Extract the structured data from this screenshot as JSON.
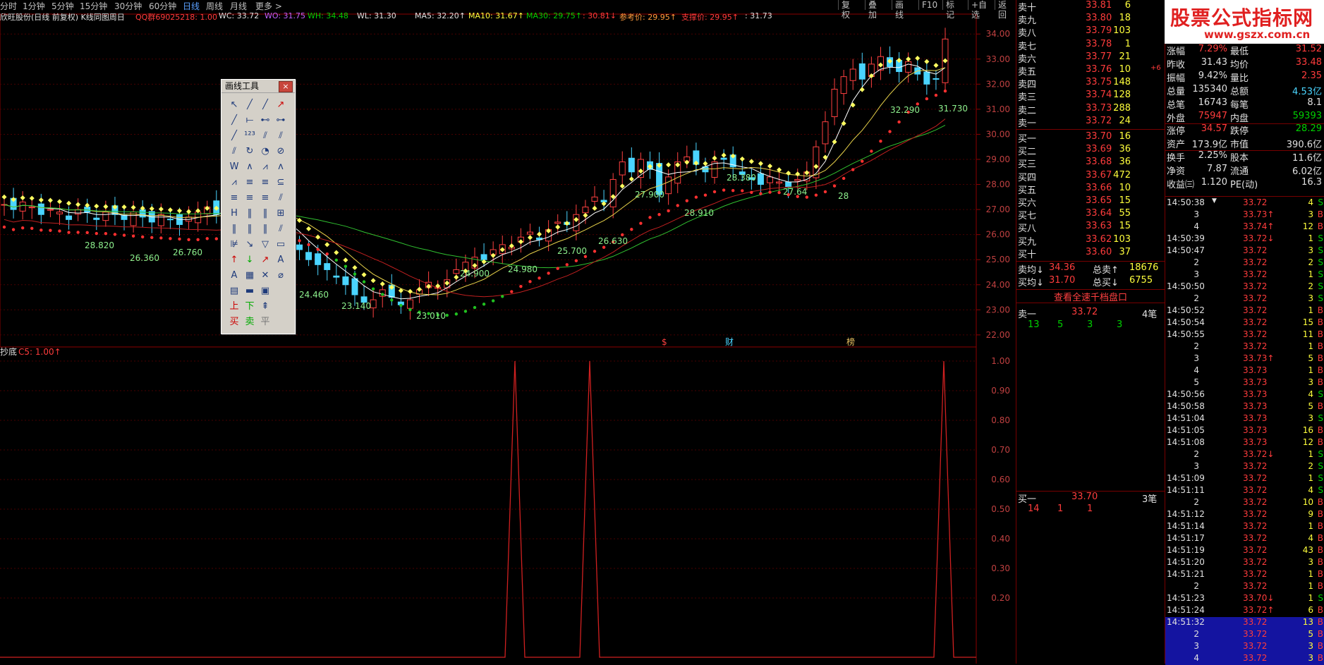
{
  "top_tabs": [
    "分时",
    "1分钟",
    "5分钟",
    "15分钟",
    "30分钟",
    "60分钟",
    "日线",
    "周线",
    "月线",
    "更多 >"
  ],
  "top_buttons": [
    "复权",
    "叠加",
    "画线",
    "F10",
    "标记",
    "+自选",
    "返回"
  ],
  "info": {
    "stock": "欣旺股份(日线 前复权) K线同图周日",
    "qq": "QQ群69025218: 1.00",
    "wc": "WC: 33.72",
    "wo": "WO: 31.75",
    "wh": "WH: 34.48",
    "wl": "WL: 31.30",
    "ma5": "MA5: 32.20↑",
    "ma10": "MA10: 31.67↑",
    "ma30": "MA30: 29.75↑",
    "ma_extra": ": 30.81↓",
    "ref": "参考价: 29.95↑",
    "support": "支撑价: 29.95↑",
    "last": ": 31.73"
  },
  "price_axis": [
    "34.00",
    "33.00",
    "32.00",
    "31.00",
    "30.00",
    "29.00",
    "28.00",
    "27.00",
    "26.00",
    "25.00",
    "24.00",
    "23.00",
    "22.00"
  ],
  "osc_axis": [
    "1.00",
    "0.90",
    "0.80",
    "0.70",
    "0.60",
    "0.50",
    "0.40",
    "0.30",
    "0.20"
  ],
  "osc_title": "抄底",
  "osc_value": "C5: 1.00↑",
  "price_labels": [
    {
      "t": "28.820"
    },
    {
      "t": "26.360"
    },
    {
      "t": "26.760"
    },
    {
      "t": "24.460"
    },
    {
      "t": "23.140"
    },
    {
      "t": "23.010"
    },
    {
      "t": "24.900"
    },
    {
      "t": "24.980"
    },
    {
      "t": "25.700"
    },
    {
      "t": "26.630"
    },
    {
      "t": "27.900"
    },
    {
      "t": "28.910"
    },
    {
      "t": "28.380"
    },
    {
      "t": "27.64"
    },
    {
      "t": "28"
    },
    {
      "t": "32.290"
    },
    {
      "t": "31.730"
    }
  ],
  "markers": [
    "$",
    "财",
    "榜"
  ],
  "palette": {
    "title": "画线工具",
    "close": "×",
    "tools": [
      "↖",
      "╱",
      "╱",
      "↗",
      "╱",
      "⟝",
      "⊷",
      "⊶",
      "╱",
      "¹²³",
      "⫽",
      "⫽",
      "⫽",
      "↻",
      "◔",
      "⊘",
      "W",
      "∧",
      "⩘",
      "ʌ",
      "⩘",
      "≡",
      "≡",
      "⊆",
      "≡",
      "≡",
      "≡",
      "⫽",
      "H",
      "‖",
      "‖",
      "⊞",
      "‖",
      "‖",
      "‖",
      "⫽",
      "⊯",
      "↘",
      "▽",
      "▭",
      "↑",
      "↓",
      "↗",
      "A",
      "A",
      "▦",
      "✕",
      "⌀",
      "▤",
      "▬",
      "▣",
      "",
      "上",
      "下",
      "⇞",
      "",
      "买",
      "卖",
      "平",
      ""
    ]
  },
  "orderbook": {
    "asks": [
      {
        "l": "卖十",
        "p": "33.81",
        "v": "6",
        "flag": "*"
      },
      {
        "l": "卖九",
        "p": "33.80",
        "v": "18"
      },
      {
        "l": "卖八",
        "p": "33.79",
        "v": "103"
      },
      {
        "l": "卖七",
        "p": "33.78",
        "v": "1"
      },
      {
        "l": "卖六",
        "p": "33.77",
        "v": "21"
      },
      {
        "l": "卖五",
        "p": "33.76",
        "v": "10",
        "x": "+6"
      },
      {
        "l": "卖四",
        "p": "33.75",
        "v": "148"
      },
      {
        "l": "卖三",
        "p": "33.74",
        "v": "128"
      },
      {
        "l": "卖二",
        "p": "33.73",
        "v": "288"
      },
      {
        "l": "卖一",
        "p": "33.72",
        "v": "24"
      }
    ],
    "bids": [
      {
        "l": "买一",
        "p": "33.70",
        "v": "16"
      },
      {
        "l": "买二",
        "p": "33.69",
        "v": "36"
      },
      {
        "l": "买三",
        "p": "33.68",
        "v": "36"
      },
      {
        "l": "买四",
        "p": "33.67",
        "v": "472"
      },
      {
        "l": "买五",
        "p": "33.66",
        "v": "10"
      },
      {
        "l": "买六",
        "p": "33.65",
        "v": "15"
      },
      {
        "l": "买七",
        "p": "33.64",
        "v": "55"
      },
      {
        "l": "买八",
        "p": "33.63",
        "v": "15"
      },
      {
        "l": "买九",
        "p": "33.62",
        "v": "103"
      },
      {
        "l": "买十",
        "p": "33.60",
        "v": "37",
        "flag": "*"
      }
    ],
    "avg_ask_label": "卖均",
    "avg_ask": "34.36",
    "total_ask_label": "总卖",
    "total_ask": "18676",
    "avg_bid_label": "买均",
    "avg_bid": "31.70",
    "total_bid_label": "总买",
    "total_bid": "6755",
    "full_depth": "查看全速千档盘口",
    "q1_label": "卖一",
    "q1_price": "33.72",
    "q1_count": "4笔",
    "q1_orders": [
      "13",
      "5",
      "3",
      "3"
    ],
    "q2_label": "买一",
    "q2_price": "33.70",
    "q2_count": "3笔",
    "q2_orders": [
      "14",
      "1",
      "1"
    ]
  },
  "stats": {
    "logo_cn": "股票公式指标网",
    "logo_url": "www.gszx.com.cn",
    "rows": [
      [
        {
          "k": "涨幅",
          "v": "7.29%",
          "c": "red"
        },
        {
          "k": "最低",
          "v": "31.52",
          "c": "red"
        }
      ],
      [
        {
          "k": "昨收",
          "v": "31.43",
          "c": "white"
        },
        {
          "k": "均价",
          "v": "33.48",
          "c": "red"
        }
      ],
      [
        {
          "k": "振幅",
          "v": "9.42%",
          "c": "white"
        },
        {
          "k": "量比",
          "v": "2.35",
          "c": "red"
        }
      ],
      [
        {
          "k": "总量",
          "v": "135340",
          "c": "white"
        },
        {
          "k": "总额",
          "v": "4.53亿",
          "c": "cyan"
        }
      ],
      [
        {
          "k": "总笔",
          "v": "16743",
          "c": "white"
        },
        {
          "k": "每笔",
          "v": "8.1",
          "c": "white"
        }
      ],
      [
        {
          "k": "外盘",
          "v": "75947",
          "c": "red"
        },
        {
          "k": "内盘",
          "v": "59393",
          "c": "green"
        }
      ],
      [
        {
          "k": "涨停",
          "v": "34.57",
          "c": "red"
        },
        {
          "k": "跌停",
          "v": "28.29",
          "c": "green"
        }
      ],
      [
        {
          "k": "资产",
          "v": "173.9亿",
          "c": "white"
        },
        {
          "k": "市值",
          "v": "390.6亿",
          "c": "white"
        }
      ],
      [
        {
          "k": "换手",
          "v": "2.25%",
          "c": "white"
        },
        {
          "k": "股本",
          "v": "11.6亿",
          "c": "white"
        }
      ],
      [
        {
          "k": "净资",
          "v": "7.87",
          "c": "white"
        },
        {
          "k": "流通",
          "v": "6.02亿",
          "c": "white"
        }
      ],
      [
        {
          "k": "收益㈢",
          "v": "1.120",
          "c": "white"
        },
        {
          "k": "PE(动)",
          "v": "16.3",
          "c": "white"
        }
      ]
    ]
  },
  "ticks": [
    {
      "t": "14:50:38",
      "p": "33.72",
      "arr": "",
      "v": "4",
      "s": "S",
      "flag": "▼"
    },
    {
      "t": "3",
      "p": "33.73",
      "arr": "↑",
      "v": "3",
      "s": "B"
    },
    {
      "t": "4",
      "p": "33.74",
      "arr": "↑",
      "v": "12",
      "s": "B"
    },
    {
      "t": "14:50:39",
      "p": "33.72",
      "arr": "↓",
      "v": "1",
      "s": "S"
    },
    {
      "t": "14:50:47",
      "p": "33.72",
      "arr": "",
      "v": "3",
      "s": "S"
    },
    {
      "t": "2",
      "p": "33.72",
      "arr": "",
      "v": "2",
      "s": "S"
    },
    {
      "t": "3",
      "p": "33.72",
      "arr": "",
      "v": "1",
      "s": "S"
    },
    {
      "t": "14:50:50",
      "p": "33.72",
      "arr": "",
      "v": "2",
      "s": "S"
    },
    {
      "t": "2",
      "p": "33.72",
      "arr": "",
      "v": "3",
      "s": "S"
    },
    {
      "t": "14:50:52",
      "p": "33.72",
      "arr": "",
      "v": "1",
      "s": "B"
    },
    {
      "t": "14:50:54",
      "p": "33.72",
      "arr": "",
      "v": "15",
      "s": "B"
    },
    {
      "t": "14:50:55",
      "p": "33.72",
      "arr": "",
      "v": "11",
      "s": "B"
    },
    {
      "t": "2",
      "p": "33.72",
      "arr": "",
      "v": "1",
      "s": "B"
    },
    {
      "t": "3",
      "p": "33.73",
      "arr": "↑",
      "v": "5",
      "s": "B"
    },
    {
      "t": "4",
      "p": "33.73",
      "arr": "",
      "v": "1",
      "s": "B"
    },
    {
      "t": "5",
      "p": "33.73",
      "arr": "",
      "v": "3",
      "s": "B"
    },
    {
      "t": "14:50:56",
      "p": "33.73",
      "arr": "",
      "v": "4",
      "s": "S"
    },
    {
      "t": "14:50:58",
      "p": "33.73",
      "arr": "",
      "v": "5",
      "s": "B"
    },
    {
      "t": "14:51:04",
      "p": "33.73",
      "arr": "",
      "v": "3",
      "s": "S"
    },
    {
      "t": "14:51:05",
      "p": "33.73",
      "arr": "",
      "v": "16",
      "s": "B"
    },
    {
      "t": "14:51:08",
      "p": "33.73",
      "arr": "",
      "v": "12",
      "s": "B"
    },
    {
      "t": "2",
      "p": "33.72",
      "arr": "↓",
      "v": "1",
      "s": "S"
    },
    {
      "t": "3",
      "p": "33.72",
      "arr": "",
      "v": "2",
      "s": "S"
    },
    {
      "t": "14:51:09",
      "p": "33.72",
      "arr": "",
      "v": "1",
      "s": "S"
    },
    {
      "t": "14:51:11",
      "p": "33.72",
      "arr": "",
      "v": "4",
      "s": "S"
    },
    {
      "t": "2",
      "p": "33.72",
      "arr": "",
      "v": "10",
      "s": "B"
    },
    {
      "t": "14:51:12",
      "p": "33.72",
      "arr": "",
      "v": "9",
      "s": "B"
    },
    {
      "t": "14:51:14",
      "p": "33.72",
      "arr": "",
      "v": "1",
      "s": "B"
    },
    {
      "t": "14:51:17",
      "p": "33.72",
      "arr": "",
      "v": "4",
      "s": "B"
    },
    {
      "t": "14:51:19",
      "p": "33.72",
      "arr": "",
      "v": "43",
      "s": "B"
    },
    {
      "t": "14:51:20",
      "p": "33.72",
      "arr": "",
      "v": "3",
      "s": "B"
    },
    {
      "t": "14:51:21",
      "p": "33.72",
      "arr": "",
      "v": "1",
      "s": "B"
    },
    {
      "t": "2",
      "p": "33.72",
      "arr": "",
      "v": "1",
      "s": "B"
    },
    {
      "t": "14:51:23",
      "p": "33.70",
      "arr": "↓",
      "v": "1",
      "s": "S"
    },
    {
      "t": "14:51:24",
      "p": "33.72",
      "arr": "↑",
      "v": "6",
      "s": "B"
    },
    {
      "t": "14:51:32",
      "p": "33.72",
      "arr": "",
      "v": "13",
      "s": "B",
      "hl": true
    },
    {
      "t": "2",
      "p": "33.72",
      "arr": "",
      "v": "5",
      "s": "B",
      "hl": true
    },
    {
      "t": "3",
      "p": "33.72",
      "arr": "",
      "v": "3",
      "s": "B",
      "hl": true
    },
    {
      "t": "4",
      "p": "33.72",
      "arr": "",
      "v": "3",
      "s": "B",
      "hl": true
    }
  ]
}
